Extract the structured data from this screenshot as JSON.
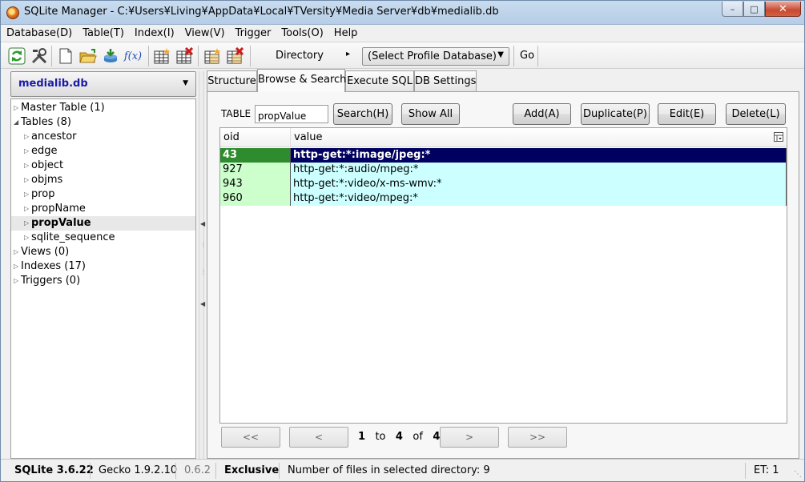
{
  "window": {
    "title": "SQLite Manager - C:¥Users¥Living¥AppData¥Local¥TVersity¥Media Server¥db¥medialib.db",
    "minimize": "–",
    "maximize": "□",
    "close": "✕"
  },
  "menu": [
    "Database(D)",
    "Table(T)",
    "Index(I)",
    "View(V)",
    "Trigger",
    "Tools(O)",
    "Help"
  ],
  "toolbar": {
    "directory_label": "Directory",
    "directory_arrow": "▸",
    "profile_select": "(Select Profile Database)",
    "go_label": "Go",
    "fx_label": "f(x)"
  },
  "database": {
    "selected": "medialib.db",
    "dropdown_arrow": "▼"
  },
  "tree": {
    "master_table": "Master Table (1)",
    "tables": "Tables (8)",
    "table_items": [
      "ancestor",
      "edge",
      "object",
      "objms",
      "prop",
      "propName",
      "propValue",
      "sqlite_sequence"
    ],
    "selected_table": "propValue",
    "views": "Views (0)",
    "indexes": "Indexes (17)",
    "triggers": "Triggers (0)"
  },
  "tabs": [
    "Structure",
    "Browse & Search",
    "Execute SQL",
    "DB Settings"
  ],
  "active_tab": "Browse & Search",
  "browse": {
    "table_label": "TABLE",
    "table_value": "propValue",
    "search_button": "Search(H)",
    "show_all_button": "Show All",
    "add_button": "Add(A)",
    "duplicate_button": "Duplicate(P)",
    "edit_button": "Edit(E)",
    "delete_button": "Delete(L)"
  },
  "grid": {
    "columns": [
      "oid",
      "value"
    ],
    "rows": [
      {
        "oid": "43",
        "value": "http-get:*:image/jpeg:*"
      },
      {
        "oid": "927",
        "value": "http-get:*:audio/mpeg:*"
      },
      {
        "oid": "943",
        "value": "http-get:*:video/x-ms-wmv:*"
      },
      {
        "oid": "960",
        "value": "http-get:*:video/mpeg:*"
      }
    ],
    "selected_row": 0
  },
  "pager": {
    "first": "<<",
    "prev": "<",
    "next": ">",
    "last": ">>",
    "from": "1",
    "to_word": "to",
    "to": "4",
    "of_word": "of",
    "total": "4"
  },
  "status": {
    "sqlite_version": "SQLite 3.6.22",
    "gecko_version": "Gecko 1.9.2.10",
    "ext_version": "0.6.2",
    "mode": "Exclusive",
    "message": "Number of files in selected directory: 9",
    "et": "ET: 1"
  }
}
